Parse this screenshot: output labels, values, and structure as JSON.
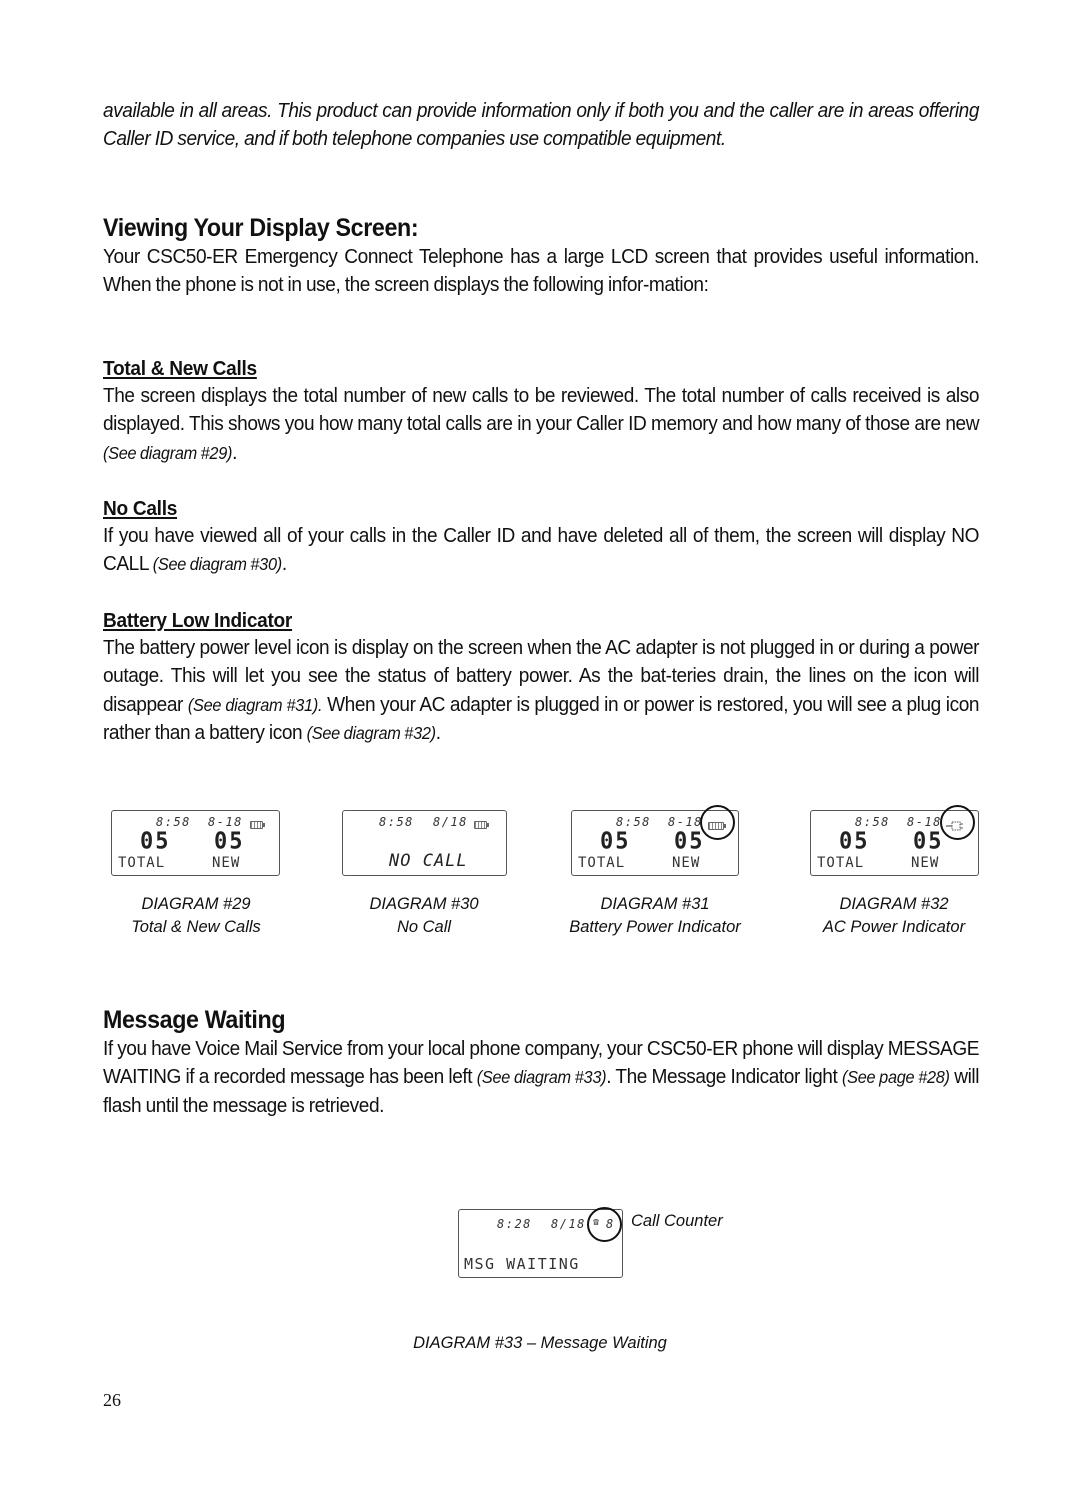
{
  "intro": {
    "text": "available in all areas. This product can provide information only if both you and the caller are in areas offering Caller ID service, and if both telephone companies use compatible equipment."
  },
  "display_section": {
    "heading": "Viewing Your Display Screen:",
    "body": "Your CSC50-ER Emergency Connect Telephone has a large LCD screen that provides useful information. When the phone is not in use, the screen displays the following infor-mation:"
  },
  "total_new": {
    "heading": "Total & New Calls",
    "body": "The screen displays the total number of new calls to be reviewed. The total number of calls received is also displayed. This shows you how many total calls are in your Caller ID memory and how many of those are new",
    "ref": "(See diagram #29)",
    "end": "."
  },
  "no_calls": {
    "heading": "No Calls",
    "body": "If you have viewed all of your calls in the Caller ID and have deleted all of them, the screen will display NO CALL",
    "ref": "(See diagram #30)",
    "end": "."
  },
  "battery": {
    "heading": "Battery Low Indicator",
    "body1": "The battery power level icon is display on the screen when the AC adapter is not plugged in or during a power outage. This will let you see the status of battery power. As the bat-teries drain, the lines on the icon will disappear",
    "ref1": "(See diagram #31).",
    "body2": "When your AC adapter is plugged in or power is restored, you will see a plug icon rather than a battery icon",
    "ref2": "(See diagram #32)",
    "end": "."
  },
  "diagrams": [
    {
      "time": "8:58",
      "date": "8-18",
      "total": "05",
      "new": "05",
      "total_label": "TOTAL",
      "new_label": "NEW",
      "title": "DIAGRAM  #29",
      "caption": "Total & New Calls",
      "icon": "battery-icon"
    },
    {
      "time": "8:58",
      "date": "8/18",
      "message": "NO CALL",
      "title": "DIAGRAM  #30",
      "caption": "No Call",
      "icon": "battery-icon"
    },
    {
      "time": "8:58",
      "date": "8-18",
      "total": "05",
      "new": "05",
      "total_label": "TOTAL",
      "new_label": "NEW",
      "title": "DIAGRAM  #31",
      "caption": "Battery Power Indicator",
      "icon": "battery-icon"
    },
    {
      "time": "8:58",
      "date": "8-18",
      "total": "05",
      "new": "05",
      "total_label": "TOTAL",
      "new_label": "NEW",
      "title": "DIAGRAM  #32",
      "caption": "AC Power Indicator",
      "icon": "plug-icon"
    }
  ],
  "message_waiting": {
    "heading": "Message Waiting",
    "body1": "If you have Voice Mail Service from your local phone company, your CSC50-ER phone will display MESSAGE WAITING if a recorded message has been left",
    "ref1": "(See diagram #33)",
    "body2": ". The Message Indicator light",
    "ref2": "(See page #28)",
    "body3": "will flash until the message is retrieved."
  },
  "diagram33": {
    "time": "8:28",
    "date": "8/18",
    "counter": "8",
    "message": "MSG  WAITING",
    "callout": "Call Counter",
    "caption": "DIAGRAM  #33 – Message Waiting"
  },
  "page_number": "26"
}
